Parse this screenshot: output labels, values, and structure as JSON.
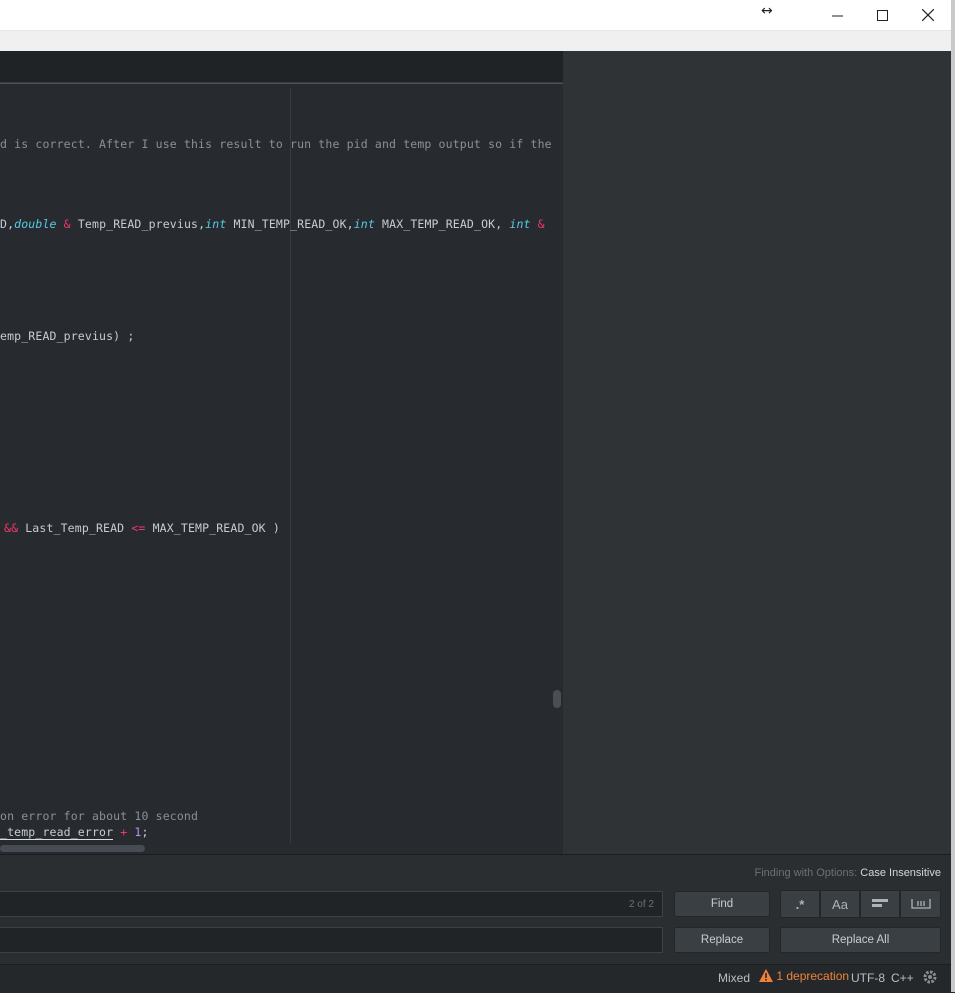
{
  "window": {
    "resize_glyph": "↔",
    "minimize_glyph": "—",
    "maximize_glyph": "☐",
    "close_glyph": "✕"
  },
  "editor": {
    "lines": {
      "comment1": "d is correct. After I use this result to run the pid and temp output so if the",
      "sig_a": "D,",
      "sig_double": "double",
      "sig_amp1": " & ",
      "sig_b": "Temp_READ_previus,",
      "sig_int1": "int",
      "sig_c": " MIN_TEMP_READ_OK,",
      "sig_int2": "int",
      "sig_d": " MAX_TEMP_READ_OK, ",
      "sig_int3": "int",
      "sig_amp2": " &",
      "prev_line": "emp_READ_previus) ;",
      "cond_and": "&&",
      "cond_mid": " Last_Temp_READ ",
      "cond_le": "<=",
      "cond_end": " MAX_TEMP_READ_OK )",
      "comment2": "on error for about 10 second",
      "err_underlined": "_temp_read_error",
      "err_plus": " + ",
      "err_num": "1",
      "err_semi": ";"
    }
  },
  "find": {
    "options_prefix": "Finding with Options: ",
    "options_value": "Case Insensitive",
    "count": "2 of 2",
    "find_label": "Find",
    "replace_label": "Replace",
    "replace_all_label": "Replace All",
    "regex_glyph": ".*",
    "case_glyph": "Aa"
  },
  "status": {
    "line_ending": "Mixed",
    "deprecation": "1 deprecation",
    "encoding": "UTF-8",
    "grammar": "C++"
  }
}
